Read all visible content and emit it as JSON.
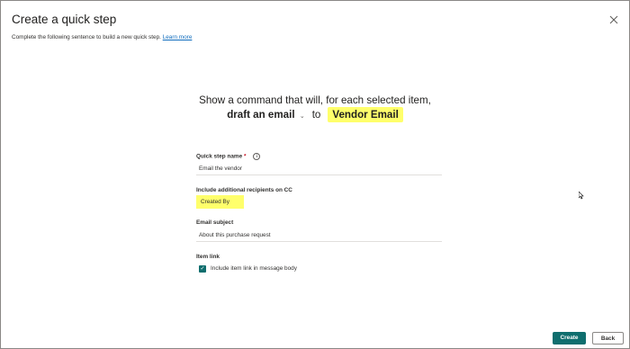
{
  "dialog": {
    "title": "Create a quick step",
    "subtitle": "Complete the following sentence to build a new quick step.",
    "learn_more": "Learn more"
  },
  "sentence": {
    "line1": "Show a command that will, for each selected item,",
    "action": "draft an email",
    "connector": "to",
    "target": "Vendor Email"
  },
  "form": {
    "name_label": "Quick step name",
    "name_required": "*",
    "name_value": "Email the vendor",
    "cc_label": "Include additional recipients on CC",
    "cc_value": "Created By",
    "subject_label": "Email subject",
    "subject_value": "About this purchase request",
    "item_link_label": "Item link",
    "item_link_checkbox_label": "Include item link in message body",
    "item_link_checked": true
  },
  "footer": {
    "create_label": "Create",
    "back_label": "Back"
  },
  "colors": {
    "accent": "#0f6e6e",
    "highlight": "#ffff6b",
    "link": "#0f6cbd"
  }
}
